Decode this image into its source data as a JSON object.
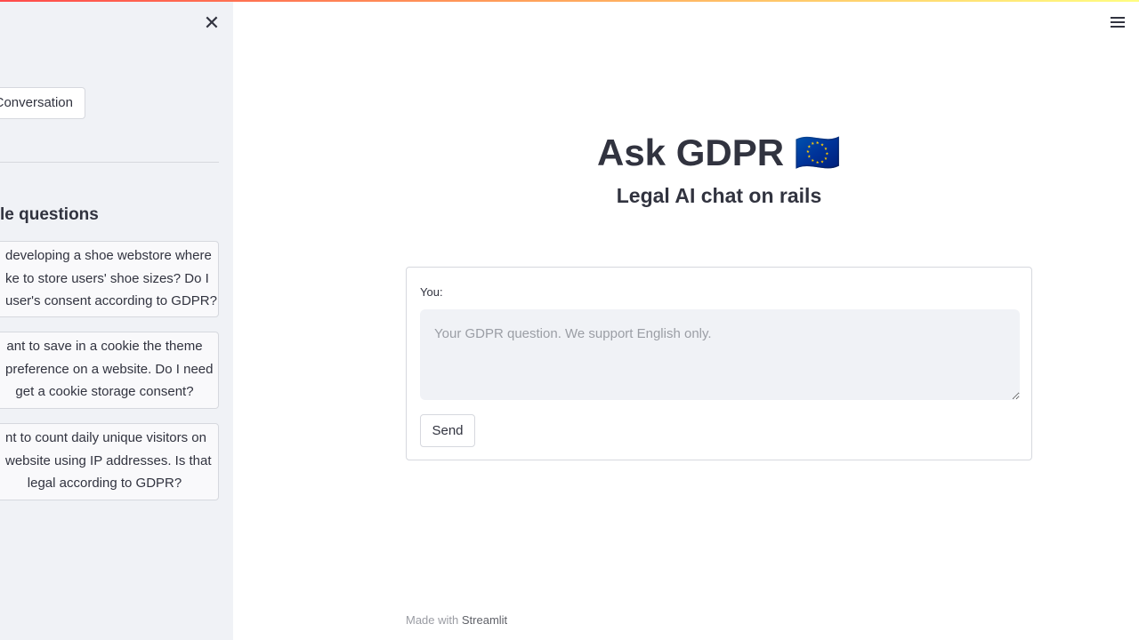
{
  "app": {
    "title": "Ask GDPR 🇪🇺",
    "subtitle": "Legal AI chat on rails"
  },
  "sidebar": {
    "close_icon": "close-icon",
    "new_conversation_label": "Conversation",
    "examples_heading": "le questions",
    "examples": [
      {
        "lines": [
          "developing a shoe webstore where",
          "ke to store users' shoe sizes? Do I",
          "user's consent according to GDPR?"
        ]
      },
      {
        "lines": [
          "ant to save in a cookie the theme",
          "preference on a website. Do I need",
          "get a cookie storage consent?"
        ]
      },
      {
        "lines": [
          "nt to count daily unique visitors on",
          "website using IP addresses. Is that",
          "legal according to GDPR?"
        ]
      }
    ]
  },
  "header": {
    "menu_icon": "hamburger-menu-icon"
  },
  "form": {
    "label": "You:",
    "input_value": "",
    "input_placeholder": "Your GDPR question. We support English only.",
    "send_label": "Send"
  },
  "footer": {
    "prefix": "Made with",
    "brand": "Streamlit"
  },
  "colors": {
    "sidebar_bg": "#f0f2f6",
    "text": "#31333f",
    "border": "#d6d8de",
    "accent_gradient_start": "#ff4b4b",
    "accent_gradient_end": "#fffd80"
  }
}
